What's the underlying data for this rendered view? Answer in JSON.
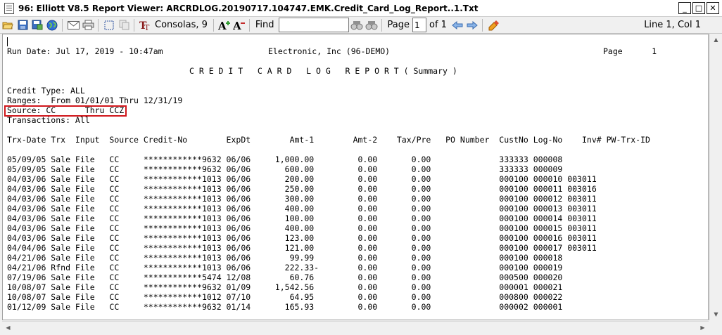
{
  "window": {
    "title": "96: Elliott V8.5 Report Viewer: ARCRDLOG.20190717.104747.EMK.Credit_Card_Log_Report..1.Txt",
    "minimize": "_",
    "maximize": "□",
    "close": "✕"
  },
  "toolbar": {
    "font_label": "Consolas, 9",
    "find_label": "Find",
    "find_value": "",
    "page_label": "Page",
    "page_value": "1",
    "page_of": "of 1",
    "cursor_position": "Line 1, Col 1"
  },
  "report": {
    "header_run_date": "Run Date: Jul 17, 2019 - 10:47am",
    "header_company": "Electronic, Inc (96-DEMO)",
    "header_page": "Page      1",
    "title": "C R E D I T   C A R D   L O G   R E P O R T ( Summary )",
    "credit_type": "Credit Type: ALL",
    "ranges": "Ranges:  From 01/01/01 Thru 12/31/19",
    "source": "Source: CC      Thru CCZ",
    "transactions": "Transactions: All",
    "column_headers": "Trx-Date Trx  Input  Source Credit-No        ExpDt        Amt-1        Amt-2    Tax/Pre   PO Number  CustNo Log-No    Inv# PW-Trx-ID",
    "rows": [
      "05/09/05 Sale File   CC     ************9632 06/06     1,000.00         0.00       0.00              333333 000008",
      "05/09/05 Sale File   CC     ************9632 06/06       600.00         0.00       0.00              333333 000009",
      "04/03/06 Sale File   CC     ************1013 06/06       200.00         0.00       0.00              000100 000010 003011",
      "04/03/06 Sale File   CC     ************1013 06/06       250.00         0.00       0.00              000100 000011 003016",
      "04/03/06 Sale File   CC     ************1013 06/06       300.00         0.00       0.00              000100 000012 003011",
      "04/03/06 Sale File   CC     ************1013 06/06       400.00         0.00       0.00              000100 000013 003011",
      "04/03/06 Sale File   CC     ************1013 06/06       100.00         0.00       0.00              000100 000014 003011",
      "04/03/06 Sale File   CC     ************1013 06/06       400.00         0.00       0.00              000100 000015 003011",
      "04/03/06 Sale File   CC     ************1013 06/06       123.00         0.00       0.00              000100 000016 003011",
      "04/04/06 Sale File   CC     ************1013 06/06       121.00         0.00       0.00              000100 000017 003011",
      "04/21/06 Sale File   CC     ************1013 06/06        99.99         0.00       0.00              000100 000018",
      "04/21/06 Rfnd File   CC     ************1013 06/06       222.33-        0.00       0.00              000100 000019",
      "07/19/06 Sale File   CC     ************5474 12/08        60.76         0.00       0.00              000500 000020",
      "10/08/07 Sale File   CC     ************9632 01/09     1,542.56         0.00       0.00              000001 000021",
      "10/08/07 Sale File   CC     ************1012 07/10        64.95         0.00       0.00              000800 000022",
      "01/12/09 Sale File   CC     ************9632 01/14       165.93         0.00       0.00              000002 000001"
    ]
  },
  "colors": {
    "highlight": "#d0161b",
    "background": "#ffffff",
    "chrome": "#f0f0f0"
  },
  "icons": [
    "document-icon",
    "open-folder-icon",
    "save-icon",
    "save-as-icon",
    "globe-icon",
    "email-icon",
    "print-icon",
    "select-icon",
    "copy-icon",
    "font-icon",
    "grow-font-icon",
    "shrink-font-icon",
    "find-next-icon",
    "find-prev-icon",
    "prev-page-icon",
    "next-page-icon",
    "highlighter-icon"
  ]
}
